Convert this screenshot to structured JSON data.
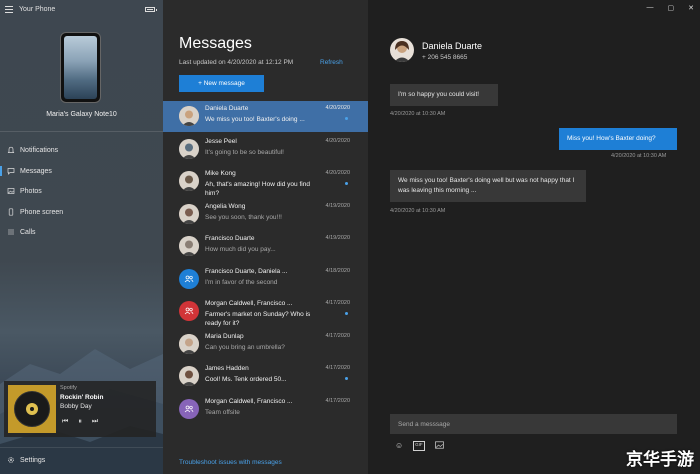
{
  "app": {
    "title": "Your Phone"
  },
  "device": {
    "name": "Maria's Galaxy Note10"
  },
  "nav": [
    {
      "label": "Notifications",
      "icon": "bell-icon"
    },
    {
      "label": "Messages",
      "icon": "chat-icon",
      "active": true
    },
    {
      "label": "Photos",
      "icon": "image-icon"
    },
    {
      "label": "Phone screen",
      "icon": "phone-screen-icon"
    },
    {
      "label": "Calls",
      "icon": "dialpad-icon"
    }
  ],
  "player": {
    "source": "Spotify",
    "song": "Rockin' Robin",
    "artist": "Bobby Day",
    "controls": {
      "prev": "⏮",
      "play_pause": "⏸",
      "next": "⏭"
    }
  },
  "settings": {
    "label": "Settings"
  },
  "messages_list": {
    "title": "Messages",
    "last_updated": "Last updated on 4/20/2020 at 12:12 PM",
    "refresh_label": "Refresh",
    "new_message_label": "+ New message",
    "troubleshoot_label": "Troubleshoot issues with messages",
    "conversations": [
      {
        "name": "Daniela Duarte",
        "preview": "We miss you too! Baxter's doing ...",
        "date": "4/20/2020",
        "unread": true,
        "selected": true,
        "avatar_color": "#c9a27e"
      },
      {
        "name": "Jesse Peel",
        "preview": "It's going to be so beautiful!",
        "date": "4/20/2020",
        "unread": false,
        "avatar_color": "#5b6f80"
      },
      {
        "name": "Mike Kong",
        "preview": "Ah, that's amazing! How did you find him?",
        "date": "4/20/2020",
        "unread": true,
        "avatar_color": "#6b5a4a"
      },
      {
        "name": "Angelia Wong",
        "preview": "See you soon, thank you!!!",
        "date": "4/19/2020",
        "unread": false,
        "avatar_color": "#7a5d50"
      },
      {
        "name": "Francisco Duarte",
        "preview": "How much did you pay...",
        "date": "4/19/2020",
        "unread": false,
        "avatar_color": "#8a7e74"
      },
      {
        "name": "Francisco Duarte, Daniela ...",
        "preview": "I'm in favor of the second",
        "date": "4/18/2020",
        "unread": false,
        "avatar_color": "#1e7fd6",
        "group": true
      },
      {
        "name": "Morgan Caldwell, Francisco ...",
        "preview": "Farmer's market on Sunday? Who is ready for it?",
        "date": "4/17/2020",
        "unread": true,
        "avatar_color": "#d13438",
        "group": true
      },
      {
        "name": "Maria Dunlap",
        "preview": "Can you bring an umbrella?",
        "date": "4/17/2020",
        "unread": false,
        "avatar_color": "#c4a48a"
      },
      {
        "name": "James Hadden",
        "preview": "Cool! Ms. Tenk ordered 50...",
        "date": "4/17/2020",
        "unread": true,
        "avatar_color": "#6e5040"
      },
      {
        "name": "Morgan Caldwell, Francisco ...",
        "preview": "Team offsite",
        "date": "4/17/2020",
        "unread": false,
        "avatar_color": "#8764b8",
        "group": true
      }
    ]
  },
  "conversation": {
    "contact_name": "Daniela Duarte",
    "contact_phone": "+ 206 545 8665",
    "messages": [
      {
        "direction": "in",
        "text": "I'm so happy you could visit!",
        "time": "4/20/2020 at 10:30 AM"
      },
      {
        "direction": "out",
        "text": "Miss you! How's Baxter doing?",
        "time": "4/20/2020 at 10:30 AM"
      },
      {
        "direction": "in",
        "text": "We miss you too! Baxter's doing well but was not happy that I was leaving this morning ...",
        "time": "4/20/2020 at 10:30 AM"
      }
    ],
    "composer_placeholder": "Send a messsage",
    "tools": {
      "emoji": "☺",
      "gif": "GIF",
      "image": "image-icon"
    }
  },
  "window_controls": {
    "minimize": "—",
    "maximize": "▢",
    "close": "✕"
  },
  "watermark": "京华手游",
  "colors": {
    "accent": "#1e7fd6",
    "selected_row": "#3f6fa6",
    "link": "#4aa1e8"
  }
}
